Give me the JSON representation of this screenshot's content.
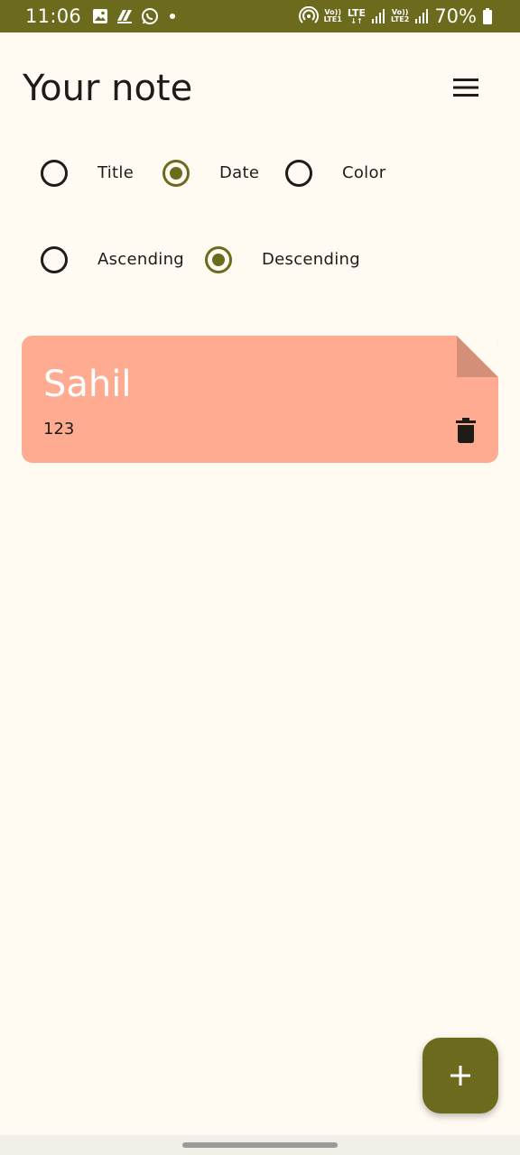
{
  "status_bar": {
    "time": "11:06",
    "left_icons": [
      "gallery-icon",
      "app-icon",
      "whatsapp-icon",
      "dot-icon"
    ],
    "sim1_label_top": "Vo))",
    "sim1_label_bottom": "LTE1",
    "lte_label": "LTE",
    "sim2_label_top": "Vo))",
    "sim2_label_bottom": "LTE2",
    "battery": "70%",
    "color": "#6b6a1d"
  },
  "header": {
    "title": "Your note",
    "menu_icon": "menu-icon"
  },
  "sort_by": {
    "options": [
      {
        "label": "Title",
        "checked": false
      },
      {
        "label": "Date",
        "checked": true
      },
      {
        "label": "Color",
        "checked": false
      }
    ]
  },
  "order": {
    "options": [
      {
        "label": "Ascending",
        "checked": false
      },
      {
        "label": "Descending",
        "checked": true
      }
    ]
  },
  "notes": [
    {
      "title": "Sahil",
      "content": "123",
      "color": "#ffab91",
      "delete_icon": "delete-icon"
    }
  ],
  "fab": {
    "icon": "add-icon"
  },
  "colors": {
    "accent": "#6b6a1d",
    "background": "#fffbf2",
    "note": "#ffab91"
  }
}
